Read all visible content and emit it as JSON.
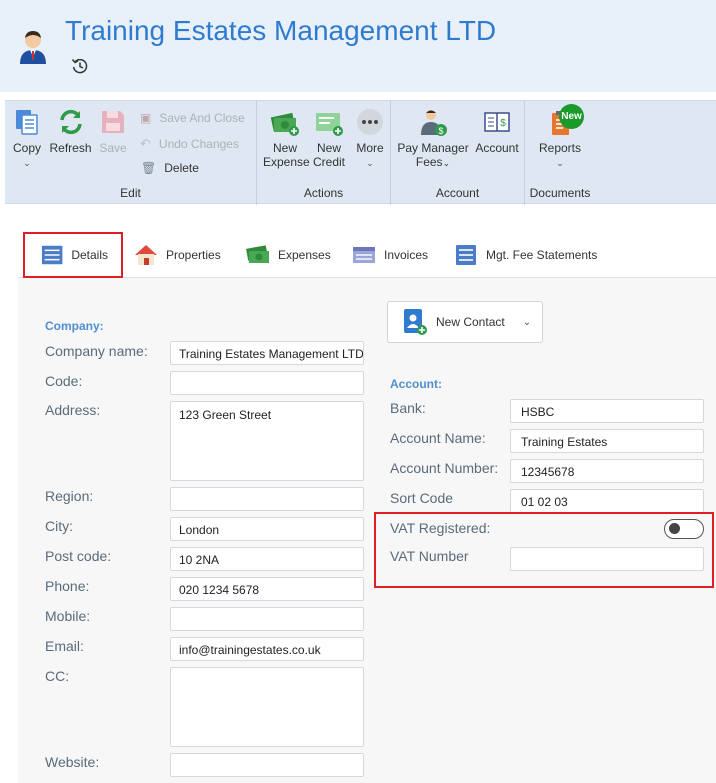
{
  "header": {
    "title": "Training Estates Management LTD"
  },
  "ribbon": {
    "edit": {
      "label": "Edit",
      "copy": "Copy",
      "refresh": "Refresh",
      "save": "Save",
      "save_and_close": "Save And Close",
      "undo_changes": "Undo Changes",
      "delete": "Delete"
    },
    "actions": {
      "label": "Actions",
      "new_expense_l1": "New",
      "new_expense_l2": "Expense",
      "new_credit_l1": "New",
      "new_credit_l2": "Credit",
      "more": "More"
    },
    "account": {
      "label": "Account",
      "pay_manager_l1": "Pay Manager",
      "pay_manager_l2": "Fees",
      "account": "Account"
    },
    "documents": {
      "label": "Documents",
      "reports": "Reports",
      "new_badge": "New"
    }
  },
  "tabs": [
    {
      "label": "Details"
    },
    {
      "label": "Properties"
    },
    {
      "label": "Expenses"
    },
    {
      "label": "Invoices"
    },
    {
      "label": "Mgt. Fee Statements"
    }
  ],
  "company": {
    "section": "Company:",
    "fields": {
      "company_name": {
        "label": "Company name:",
        "value": "Training Estates Management LTD"
      },
      "code": {
        "label": "Code:",
        "value": ""
      },
      "address": {
        "label": "Address:",
        "value": "123 Green Street"
      },
      "region": {
        "label": "Region:",
        "value": ""
      },
      "city": {
        "label": "City:",
        "value": "London"
      },
      "post_code": {
        "label": "Post code:",
        "value": "10 2NA"
      },
      "phone": {
        "label": "Phone:",
        "value": "020 1234 5678"
      },
      "mobile": {
        "label": "Mobile:",
        "value": ""
      },
      "email": {
        "label": "Email:",
        "value": "info@trainingestates.co.uk"
      },
      "cc": {
        "label": "CC:",
        "value": ""
      },
      "website": {
        "label": "Website:",
        "value": ""
      }
    }
  },
  "new_contact": "New Contact",
  "account": {
    "section": "Account:",
    "bank": {
      "label": "Bank:",
      "value": "HSBC"
    },
    "account_name": {
      "label": "Account Name:",
      "value": "Training Estates"
    },
    "account_number": {
      "label": "Account Number:",
      "value": "12345678"
    },
    "sort_code": {
      "label": "Sort Code",
      "value": "01 02 03"
    },
    "vat_registered": {
      "label": "VAT Registered:",
      "on": false
    },
    "vat_number": {
      "label": "VAT Number",
      "value": ""
    }
  },
  "colors": {
    "accent": "#2f7bd0",
    "section": "#4f8fd0",
    "highlight": "#e02020"
  }
}
